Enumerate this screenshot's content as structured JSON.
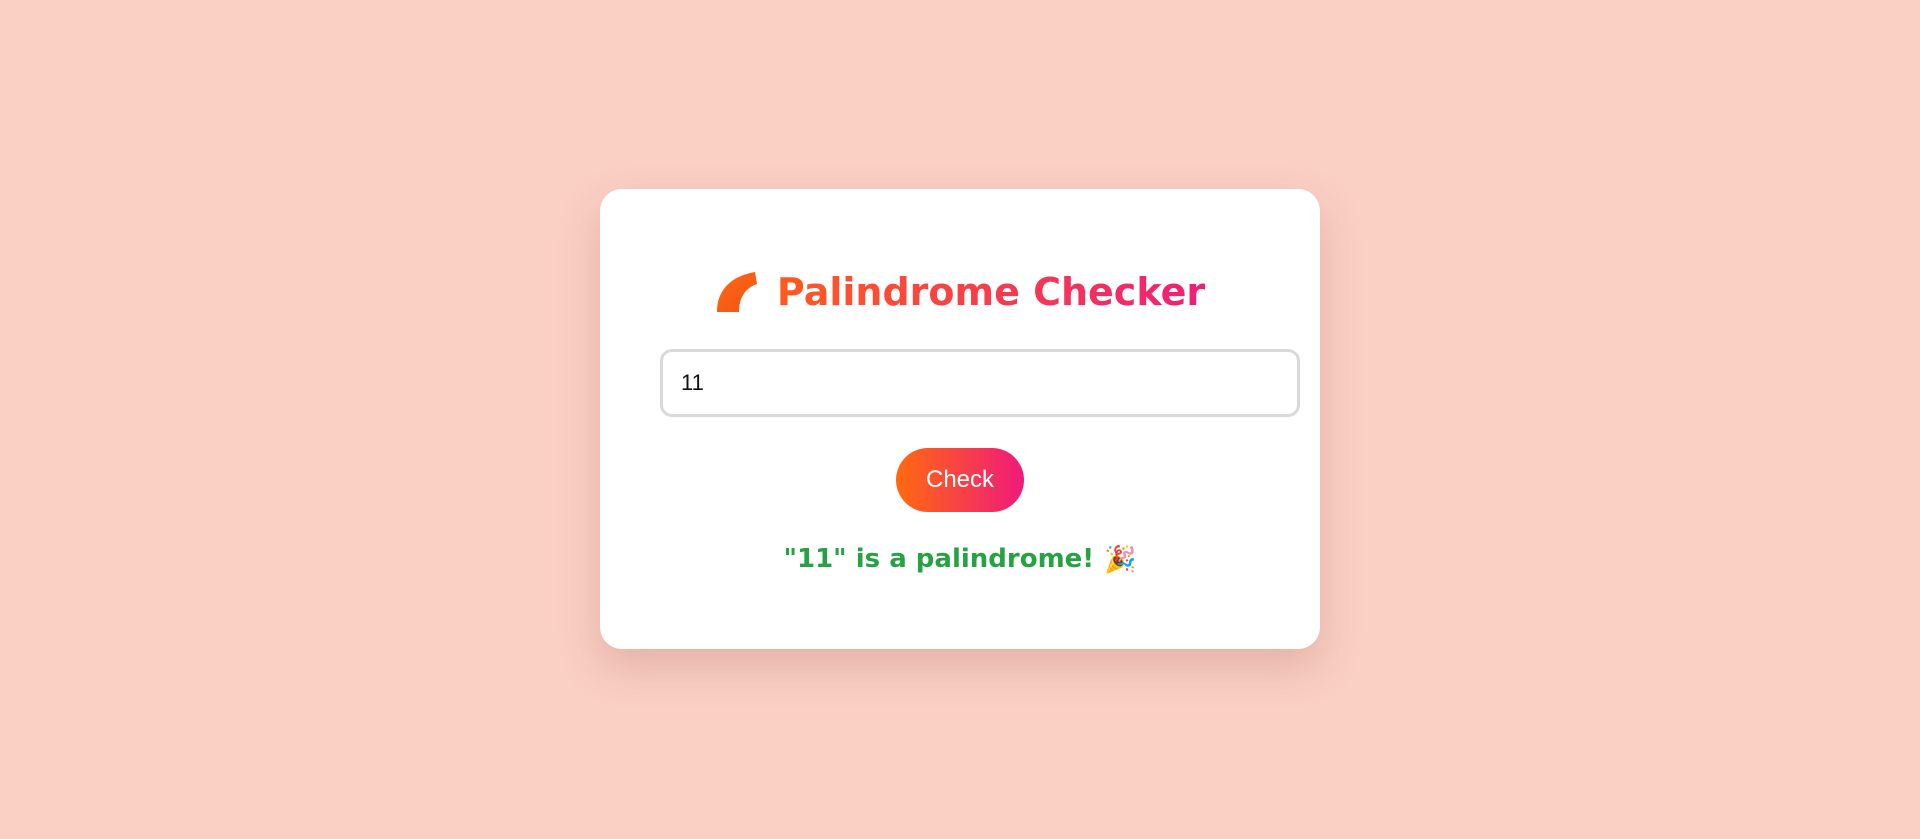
{
  "app": {
    "title": "Palindrome Checker",
    "title_icon": "leaf-icon"
  },
  "form": {
    "input_value": "11",
    "button_label": "Check"
  },
  "result": {
    "message": "\"11\" is a palindrome!",
    "icon": "party-popper-icon",
    "icon_glyph": "🎉",
    "color": "#26a244"
  },
  "colors": {
    "background": "#facfc4",
    "accent_start": "#ff6a10",
    "accent_end": "#ef1a7a",
    "card": "#ffffff"
  }
}
